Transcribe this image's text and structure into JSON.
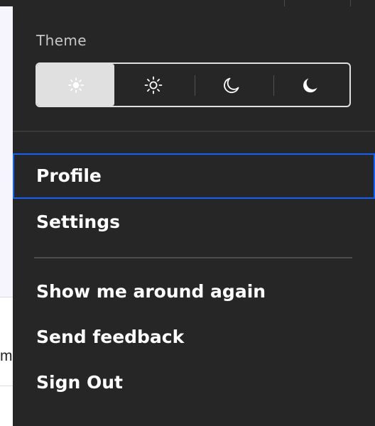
{
  "background": {
    "text_fragment": "m"
  },
  "theme": {
    "label": "Theme",
    "options": [
      {
        "icon": "sun-small-icon",
        "selected": true
      },
      {
        "icon": "sun-outline-icon",
        "selected": false
      },
      {
        "icon": "moon-outline-icon",
        "selected": false
      },
      {
        "icon": "moon-filled-icon",
        "selected": false
      }
    ]
  },
  "menu": {
    "profile": "Profile",
    "settings": "Settings",
    "show_around": "Show me around again",
    "send_feedback": "Send feedback",
    "sign_out": "Sign Out"
  },
  "colors": {
    "panel": "#262626",
    "focus": "#0f62fe",
    "selected_theme": "#e0e0e0"
  }
}
